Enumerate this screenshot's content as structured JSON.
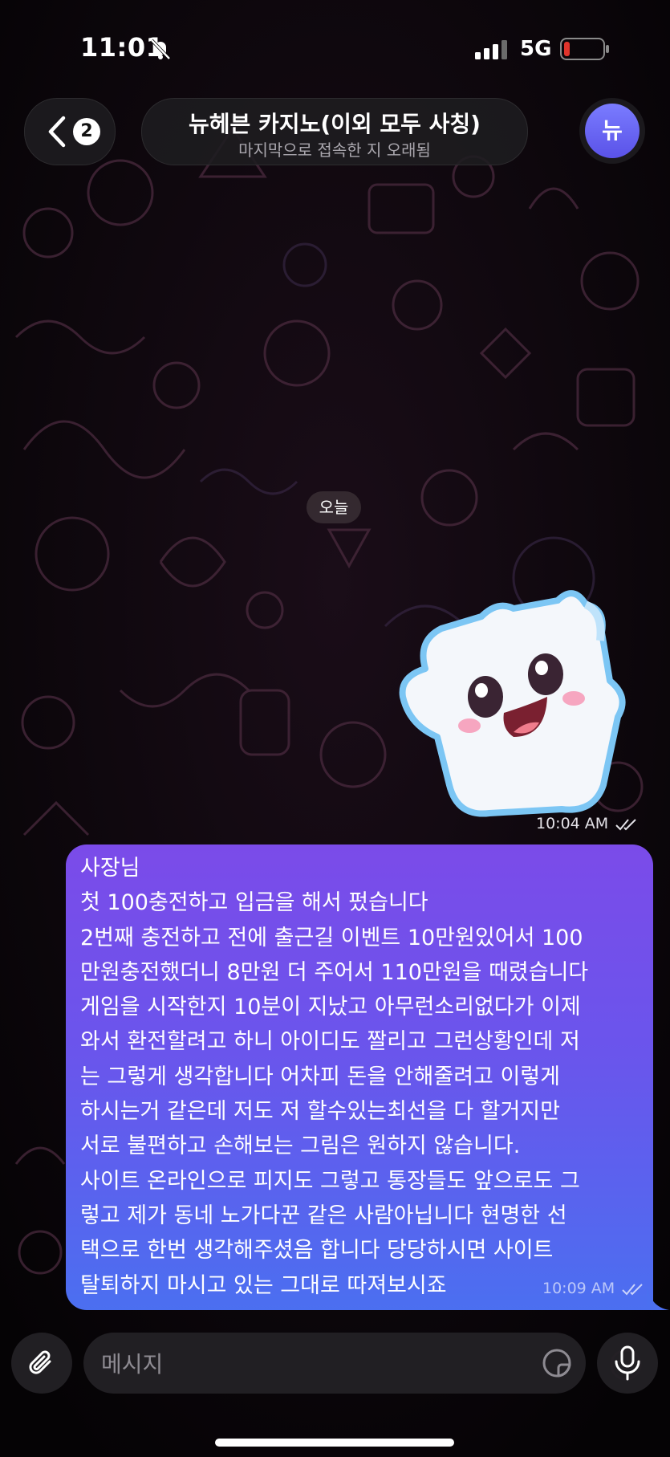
{
  "status_bar": {
    "time": "11:01",
    "network": "5G",
    "mute_icon": "bell-slash-icon",
    "signal_icon": "signal-bars-icon",
    "battery_icon": "battery-low-icon",
    "battery_color": "#e0342c"
  },
  "header": {
    "back_icon": "chevron-left-icon",
    "unread_count": "2",
    "title": "뉴헤븐 카지노(이외 모두 사칭)",
    "subtitle": "마지막으로 접속한 지 오래됨",
    "avatar_letter": "뉴",
    "avatar_color": "#6b6cf5"
  },
  "chat": {
    "date_label": "오늘",
    "sticker_message": {
      "sticker_icon": "ghost-pillow-sticker",
      "time": "10:04 AM",
      "status_icon": "double-check-icon"
    },
    "text_message": {
      "lines": [
        "사장님",
        "첫 100충전하고 입금을 해서 펐습니다",
        "2번째 충전하고 전에 출근길 이벤트 10만원있어서 100",
        "만원충전했더니 8만원 더 주어서 110만원을 때렸습니다",
        "게임을 시작한지 10분이 지났고 아무런소리없다가 이제",
        "와서 환전할려고 하니 아이디도 짤리고 그런상황인데 저",
        "는 그렇게 생각합니다 어차피 돈을 안해줄려고 이렇게",
        "하시는거 같은데 저도 저 할수있는최선을 다 할거지만",
        "서로 불편하고 손해보는 그림은 원하지 않습니다.",
        "사이트 온라인으로 피지도 그렇고 통장들도 앞으로도 그",
        "렇고 제가 동네 노가다꾼 같은 사람아닙니다 현명한 선",
        "택으로 한번 생각해주셨음 합니다  당당하시면 사이트",
        "탈퇴하지 마시고 있는 그대로 따져보시죠"
      ],
      "time": "10:09 AM",
      "status_icon": "double-check-icon",
      "bubble_colors": [
        "#7b4be9",
        "#4b6ff0"
      ]
    }
  },
  "composer": {
    "attach_icon": "paperclip-icon",
    "placeholder": "메시지",
    "sticker_icon": "sticker-moon-icon",
    "mic_icon": "microphone-icon"
  }
}
